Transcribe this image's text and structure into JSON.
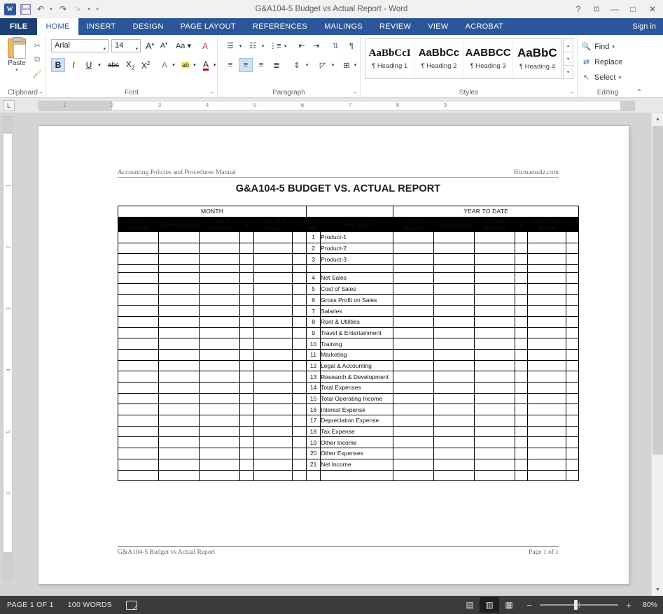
{
  "window": {
    "title": "G&A104-5 Budget vs Actual Report - Word",
    "help_icon": "?",
    "ribbon_display_icon": "ribbon-display-options",
    "minimize_icon": "—",
    "maximize_icon": "□",
    "close_icon": "✕"
  },
  "quick_access": {
    "app_icon": "word-logo",
    "items": [
      {
        "name": "save",
        "icon": "save-icon"
      },
      {
        "name": "undo",
        "icon": "undo-arrow"
      },
      {
        "name": "redo",
        "icon": "redo-arrow"
      },
      {
        "name": "touch-mouse-mode",
        "icon": "touch-mode-icon"
      },
      {
        "name": "customize",
        "icon": "chevron-down-icon"
      }
    ]
  },
  "tabs": {
    "file": "FILE",
    "items": [
      "HOME",
      "INSERT",
      "DESIGN",
      "PAGE LAYOUT",
      "REFERENCES",
      "MAILINGS",
      "REVIEW",
      "VIEW",
      "ACROBAT"
    ],
    "active": "HOME",
    "sign_in": "Sign in"
  },
  "ribbon": {
    "clipboard": {
      "label": "Clipboard",
      "paste": "Paste",
      "paste_caret": "▾",
      "cut_icon": "scissors-icon",
      "copy_icon": "copy-icon",
      "format_painter_icon": "paintbrush-icon",
      "dialog_launcher": "⌐"
    },
    "font": {
      "label": "Font",
      "font_name": "Arial",
      "font_size": "14",
      "grow_font": "A",
      "shrink_font": "A",
      "change_case": "Aa",
      "clear_formatting": "A",
      "bold": "B",
      "italic": "I",
      "underline": "U",
      "strikethrough": "abc",
      "subscript": "X₂",
      "superscript": "X²",
      "text_effects": "A",
      "highlight": "ab",
      "font_color": "A",
      "dialog_launcher": "⌐"
    },
    "paragraph": {
      "label": "Paragraph",
      "bullets_icon": "bullet-list-icon",
      "numbering_icon": "numbered-list-icon",
      "multilevel_icon": "multilevel-list-icon",
      "decrease_indent_icon": "decrease-indent-icon",
      "increase_indent_icon": "increase-indent-icon",
      "sort_icon": "sort-az-icon",
      "show_marks_icon": "¶",
      "align_left_icon": "align-left-icon",
      "align_center_icon": "align-center-icon",
      "align_right_icon": "align-right-icon",
      "justify_icon": "justify-icon",
      "line_spacing_icon": "line-spacing-icon",
      "shading_icon": "shading-icon",
      "borders_icon": "borders-icon",
      "dialog_launcher": "⌐"
    },
    "styles": {
      "label": "Styles",
      "gallery": [
        {
          "sample": "AaBbCcI",
          "name": "¶ Heading 1"
        },
        {
          "sample": "AaBbCc",
          "name": "¶ Heading 2"
        },
        {
          "sample": "AABBCC",
          "name": "¶ Heading 3"
        },
        {
          "sample": "AaBbC",
          "name": "¶ Heading 4"
        }
      ],
      "scroll_up": "▴",
      "scroll_down": "▾",
      "more": "▾",
      "dialog_launcher": "⌐"
    },
    "editing": {
      "label": "Editing",
      "find": "Find",
      "find_caret": "▾",
      "replace": "Replace",
      "select": "Select",
      "select_caret": "▾",
      "find_icon": "binoculars-icon",
      "replace_icon": "replace-icon",
      "select_icon": "cursor-select-icon",
      "collapse_ribbon": "⌃"
    }
  },
  "ruler": {
    "tab_selector": "L",
    "horizontal_marks": [
      "1",
      "2",
      "3",
      "4",
      "5",
      "6",
      "7",
      "8",
      "9"
    ],
    "vertical_marks": [
      "1",
      "2",
      "3",
      "4",
      "5",
      "6"
    ]
  },
  "document": {
    "header_left": "Accounting Policies and Procedures Manual",
    "header_right": "Bizmanualz.com",
    "title": "G&A104-5 BUDGET VS. ACTUAL REPORT",
    "footer_left": "G&A104-5 Budget vs Actual Report",
    "footer_right": "Page 1 of 1",
    "table": {
      "band_month": "MONTH",
      "band_ytd": "YEAR TO DATE",
      "headers_month": [
        "Current Budget",
        "Current Actual",
        "Current Variance",
        "%",
        "Last Year Actual",
        "%"
      ],
      "headers_center": [
        "Line No.",
        "Description"
      ],
      "headers_ytd": [
        "Current Budget",
        "Current Actual",
        "Current Variance",
        "%",
        "Last Year Actual",
        "%"
      ],
      "rows": [
        {
          "no": "1",
          "desc": "Product-1"
        },
        {
          "no": "2",
          "desc": "Product-2"
        },
        {
          "no": "3",
          "desc": "Product-3"
        },
        {
          "no": "4",
          "desc": "Net Sales"
        },
        {
          "no": "5",
          "desc": "Cost of Sales"
        },
        {
          "no": "6",
          "desc": "Gross Profit on Sales"
        },
        {
          "no": "7",
          "desc": "Salaries"
        },
        {
          "no": "8",
          "desc": "Rent & Utilities"
        },
        {
          "no": "9",
          "desc": "Travel & Entertainment"
        },
        {
          "no": "10",
          "desc": "Training"
        },
        {
          "no": "11",
          "desc": "Marketing"
        },
        {
          "no": "12",
          "desc": "Legal & Accounting"
        },
        {
          "no": "13",
          "desc": "Research & Development"
        },
        {
          "no": "14",
          "desc": "Total Expenses"
        },
        {
          "no": "15",
          "desc": "Total Operating Income"
        },
        {
          "no": "16",
          "desc": "Interest Expense"
        },
        {
          "no": "17",
          "desc": "Depreciation Expense"
        },
        {
          "no": "18",
          "desc": "Tax Expense"
        },
        {
          "no": "19",
          "desc": "Other Income"
        },
        {
          "no": "20",
          "desc": "Other Expenses"
        },
        {
          "no": "21",
          "desc": "Net Income"
        },
        {
          "no": "",
          "desc": ""
        }
      ]
    }
  },
  "status_bar": {
    "page": "PAGE 1 OF 1",
    "words": "100 WORDS",
    "proofing_icon": "proofing-errors-icon",
    "view_read_icon": "read-mode-icon",
    "view_print_icon": "print-layout-icon",
    "view_web_icon": "web-layout-icon",
    "zoom_out": "−",
    "zoom_in": "+",
    "zoom_level": "80%"
  },
  "scrollbar": {
    "up_arrow": "▲",
    "down_arrow": "▼"
  }
}
